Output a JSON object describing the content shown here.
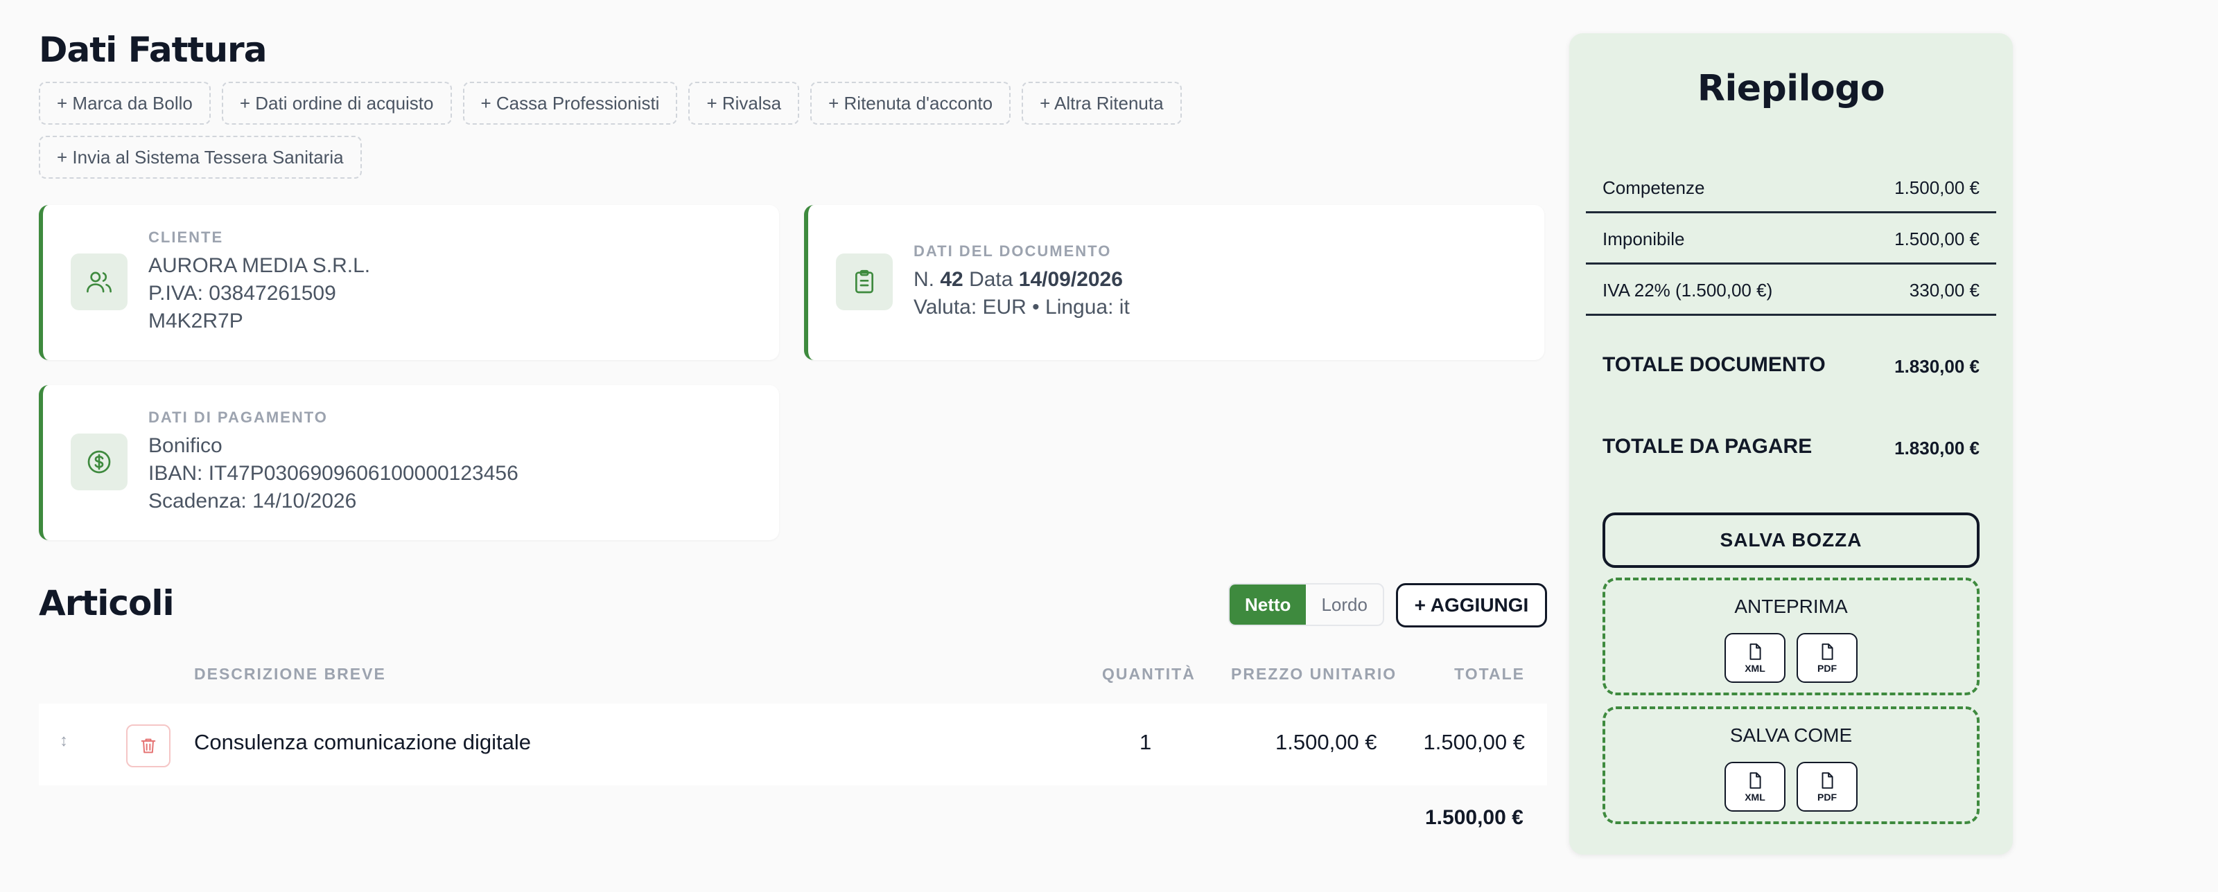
{
  "page_title": "Dati Fattura",
  "chips": [
    "+ Marca da Bollo",
    "+ Dati ordine di acquisto",
    "+ Cassa Professionisti",
    "+ Rivalsa",
    "+ Ritenuta d'acconto",
    "+ Altra Ritenuta",
    "+ Invia al Sistema Tessera Sanitaria"
  ],
  "cliente": {
    "caption": "CLIENTE",
    "name": "AURORA MEDIA S.R.L.",
    "piva": "P.IVA: 03847261509",
    "code": "M4K2R7P"
  },
  "documento": {
    "caption": "DATI DEL DOCUMENTO",
    "n_label": "N.",
    "number": "42",
    "date_label": "Data",
    "date": "14/09/2026",
    "meta": "Valuta: EUR • Lingua: it"
  },
  "pagamento": {
    "caption": "DATI DI PAGAMENTO",
    "method": "Bonifico",
    "iban": "IBAN: IT47P0306909606100000123456",
    "due": "Scadenza: 14/10/2026"
  },
  "articoli": {
    "title": "Articoli",
    "toggle_netto": "Netto",
    "toggle_lordo": "Lordo",
    "toggle_selected": "Netto",
    "add_label": "+ AGGIUNGI",
    "columns": {
      "desc": "DESCRIZIONE BREVE",
      "qty": "QUANTITÀ",
      "price": "PREZZO UNITARIO",
      "total": "TOTALE"
    },
    "rows": [
      {
        "desc": "Consulenza comunicazione digitale",
        "qty": "1",
        "price": "1.500,00 €",
        "total": "1.500,00 €"
      }
    ],
    "sum": "1.500,00 €"
  },
  "riepilogo": {
    "title": "Riepilogo",
    "rows": [
      {
        "label": "Competenze",
        "value": "1.500,00 €"
      },
      {
        "label": "Imponibile",
        "value": "1.500,00 €"
      },
      {
        "label": "IVA 22% (1.500,00 €)",
        "value": "330,00 €"
      }
    ],
    "totale_documento_label": "TOTALE DOCUMENTO",
    "totale_documento": "1.830,00 €",
    "totale_pagare_label": "TOTALE DA PAGARE",
    "totale_pagare": "1.830,00 €",
    "save_draft": "SALVA BOZZA",
    "preview_title": "ANTEPRIMA",
    "saveas_title": "SALVA COME",
    "xml": "XML",
    "pdf": "PDF"
  },
  "colors": {
    "accent": "#3e8a3e",
    "panel_bg": "#e6f1e6",
    "icon_bg": "#e6efe6",
    "danger": "#e57373"
  },
  "icons": {
    "cliente": "users-icon",
    "documento": "clipboard-icon",
    "pagamento": "dollar-circle-icon",
    "drag": "drag-handle-icon",
    "delete": "trash-icon",
    "file": "file-icon"
  }
}
